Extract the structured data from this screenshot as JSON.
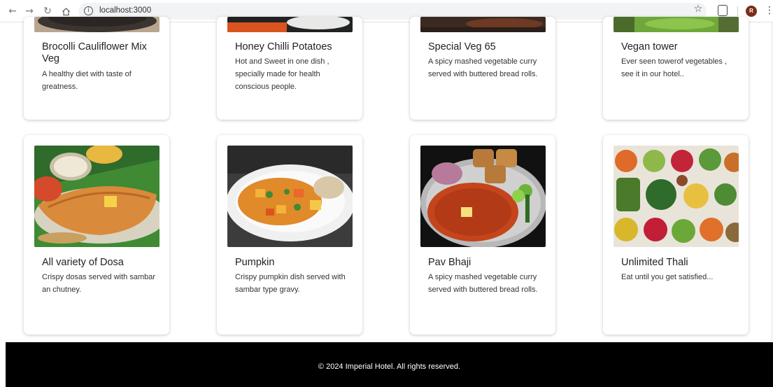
{
  "browser": {
    "url": "localhost:3000",
    "avatar_initial": "R"
  },
  "menu_items": [
    {
      "title": "Brocolli Cauliflower Mix Veg",
      "desc": "A healthy diet with taste of greatness."
    },
    {
      "title": "Honey Chilli Potatoes",
      "desc": "Hot and Sweet in one dish , specially made for health conscious people."
    },
    {
      "title": "Special Veg 65",
      "desc": "A spicy mashed vegetable curry served with buttered bread rolls."
    },
    {
      "title": "Vegan tower",
      "desc": "Ever seen towerof vegetables , see it in our hotel.."
    },
    {
      "title": "All variety of Dosa",
      "desc": "Crispy dosas served with sambar an chutney."
    },
    {
      "title": "Pumpkin",
      "desc": "Crispy pumpkin dish served with sambar type gravy."
    },
    {
      "title": "Pav Bhaji",
      "desc": "A spicy mashed vegetable curry served with buttered bread rolls."
    },
    {
      "title": "Unlimited Thali",
      "desc": "Eat until you get satisfied..."
    }
  ],
  "footer": {
    "text": "© 2024 Imperial Hotel. All rights reserved."
  },
  "colors": {
    "footer_bg": "#000000",
    "avatar_bg": "#7b2d1c"
  }
}
